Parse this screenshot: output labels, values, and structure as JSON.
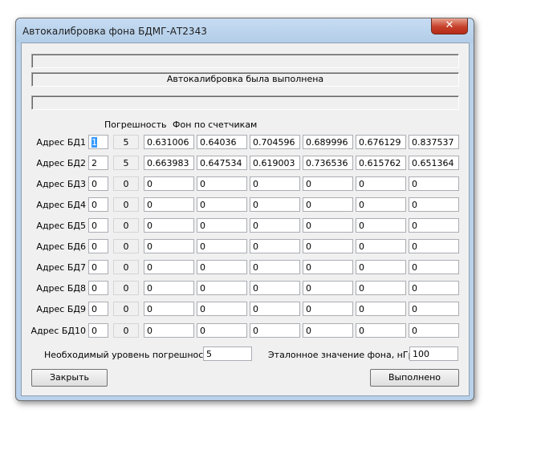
{
  "window": {
    "title": "Автокалибровка фона БДМГ-АТ2343",
    "close_glyph": "✕"
  },
  "status": {
    "message": "Автокалибровка была выполнена"
  },
  "headers": {
    "error": "Погрешность",
    "background": "Фон по счетчикам"
  },
  "rows": [
    {
      "label": "Адрес БД1",
      "address": "1",
      "error": "5",
      "counts": [
        "0.631006",
        "0.64036",
        "0.704596",
        "0.689996",
        "0.676129",
        "0.837537"
      ]
    },
    {
      "label": "Адрес БД2",
      "address": "2",
      "error": "5",
      "counts": [
        "0.663983",
        "0.647534",
        "0.619003",
        "0.736536",
        "0.615762",
        "0.651364"
      ]
    },
    {
      "label": "Адрес БД3",
      "address": "0",
      "error": "0",
      "counts": [
        "0",
        "0",
        "0",
        "0",
        "0",
        "0"
      ]
    },
    {
      "label": "Адрес БД4",
      "address": "0",
      "error": "0",
      "counts": [
        "0",
        "0",
        "0",
        "0",
        "0",
        "0"
      ]
    },
    {
      "label": "Адрес БД5",
      "address": "0",
      "error": "0",
      "counts": [
        "0",
        "0",
        "0",
        "0",
        "0",
        "0"
      ]
    },
    {
      "label": "Адрес БД6",
      "address": "0",
      "error": "0",
      "counts": [
        "0",
        "0",
        "0",
        "0",
        "0",
        "0"
      ]
    },
    {
      "label": "Адрес БД7",
      "address": "0",
      "error": "0",
      "counts": [
        "0",
        "0",
        "0",
        "0",
        "0",
        "0"
      ]
    },
    {
      "label": "Адрес БД8",
      "address": "0",
      "error": "0",
      "counts": [
        "0",
        "0",
        "0",
        "0",
        "0",
        "0"
      ]
    },
    {
      "label": "Адрес БД9",
      "address": "0",
      "error": "0",
      "counts": [
        "0",
        "0",
        "0",
        "0",
        "0",
        "0"
      ]
    },
    {
      "label": "Адрес БД10",
      "address": "0",
      "error": "0",
      "counts": [
        "0",
        "0",
        "0",
        "0",
        "0",
        "0"
      ]
    }
  ],
  "footer": {
    "required_error_label": "Необходимый уровень погрешностей",
    "required_error_value": "5",
    "reference_label": "Эталонное значение фона, нГр/ч",
    "reference_value": "100"
  },
  "buttons": {
    "close": "Закрыть",
    "done": "Выполнено"
  }
}
